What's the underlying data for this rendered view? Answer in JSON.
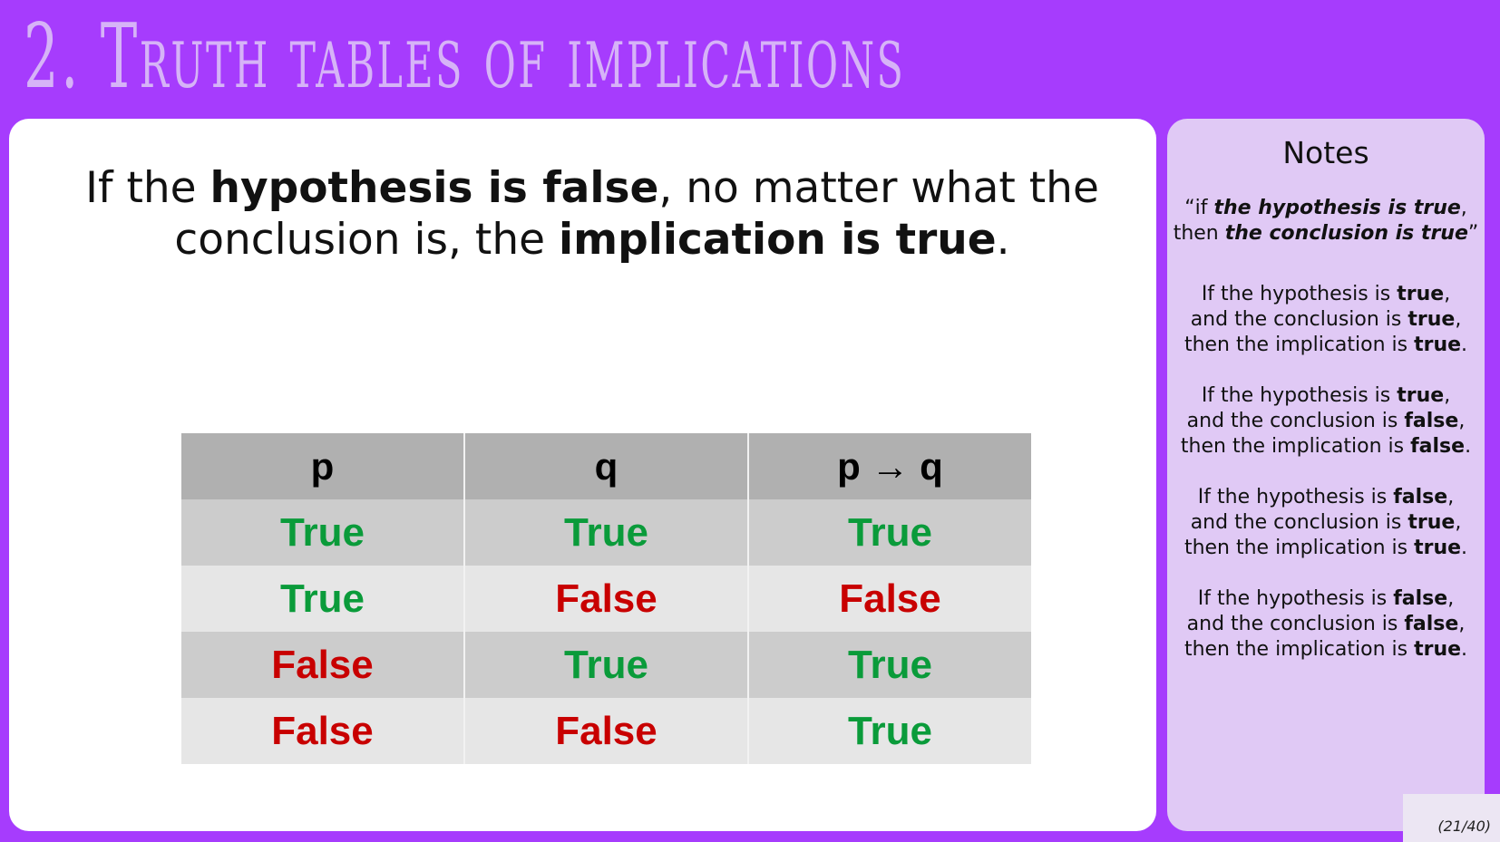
{
  "slide": {
    "title": "2. Truth tables of implications",
    "page_number": "(21/40)"
  },
  "statement": {
    "part1": "If the ",
    "bold1": "hypothesis is false",
    "part2": ", no matter what the conclusion is, the ",
    "bold2": "implication is true",
    "part3": "."
  },
  "truth_table": {
    "headers": [
      "p",
      "q",
      "p → q"
    ],
    "rows": [
      [
        "True",
        "True",
        "True"
      ],
      [
        "True",
        "False",
        "False"
      ],
      [
        "False",
        "True",
        "True"
      ],
      [
        "False",
        "False",
        "True"
      ]
    ]
  },
  "notes": {
    "title": "Notes",
    "quote": {
      "open": "“if ",
      "hyp": "the hypothesis is true",
      "mid": ", then ",
      "concl": "the conclusion is true",
      "close": "”"
    },
    "blocks": [
      {
        "l1": "If the hypothesis is ",
        "v1": "true",
        "l2": "and the conclusion is ",
        "v2": "true",
        "l3": "then the implication is ",
        "v3": "true"
      },
      {
        "l1": "If the hypothesis is ",
        "v1": "true",
        "l2": "and the conclusion is ",
        "v2": "false",
        "l3": "then the implication is ",
        "v3": "false"
      },
      {
        "l1": "If the hypothesis is ",
        "v1": "false",
        "l2": "and the conclusion is ",
        "v2": "true",
        "l3": "then the implication is ",
        "v3": "true"
      },
      {
        "l1": "If the hypothesis is ",
        "v1": "false",
        "l2": "and the conclusion is ",
        "v2": "false",
        "l3": "then the implication is ",
        "v3": "true"
      }
    ]
  },
  "colors": {
    "background": "#a63cfd",
    "title": "#d6b3f7",
    "true": "#0a9b3a",
    "false": "#c80000",
    "notes_panel": "#e0c9f5"
  }
}
